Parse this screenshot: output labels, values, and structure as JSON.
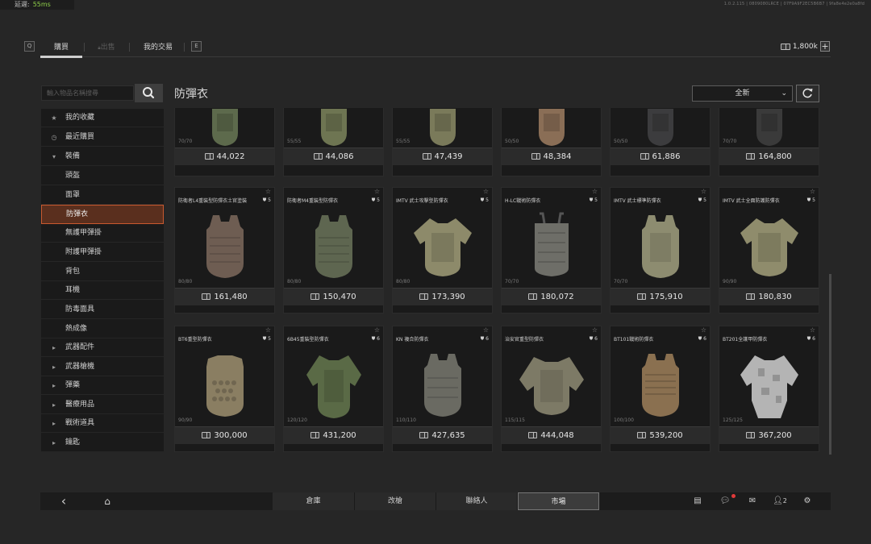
{
  "latency": {
    "label": "延遲:",
    "value": "55ms"
  },
  "build_info": "1.0.2.115 | 0809080LRCE | 07F9A9F2EC5B6B7 | 9fa8e4e2e0a8fd",
  "tabs": {
    "key_left": "Q",
    "buy": "購買",
    "sell": "出售",
    "my_trades": "我的交易",
    "key_right": "E"
  },
  "currency": {
    "amount": "1,800k",
    "plus": "+"
  },
  "search": {
    "placeholder": "輸入物品名稱搜尋"
  },
  "sidebar": {
    "items": [
      {
        "icon": "★",
        "label": "我的收藏"
      },
      {
        "icon": "◷",
        "label": "最近購買"
      },
      {
        "icon": "▾",
        "label": "裝備"
      },
      {
        "icon": "",
        "label": "頭盔"
      },
      {
        "icon": "",
        "label": "面罩"
      },
      {
        "icon": "",
        "label": "防彈衣"
      },
      {
        "icon": "",
        "label": "無護甲彈掛"
      },
      {
        "icon": "",
        "label": "附護甲彈掛"
      },
      {
        "icon": "",
        "label": "背包"
      },
      {
        "icon": "",
        "label": "耳機"
      },
      {
        "icon": "",
        "label": "防毒面具"
      },
      {
        "icon": "",
        "label": "熱成像"
      },
      {
        "icon": "▸",
        "label": "武器配件"
      },
      {
        "icon": "▸",
        "label": "武器槍機"
      },
      {
        "icon": "▸",
        "label": "彈藥"
      },
      {
        "icon": "▸",
        "label": "醫療用品"
      },
      {
        "icon": "▸",
        "label": "戰術道具"
      },
      {
        "icon": "▸",
        "label": "鑰匙"
      }
    ]
  },
  "main": {
    "title": "防彈衣",
    "filter": "全新"
  },
  "items_row1": [
    {
      "durability": "70/70",
      "price": "44,022",
      "color": "#5d6a4c"
    },
    {
      "durability": "55/55",
      "price": "44,086",
      "color": "#6e7552"
    },
    {
      "durability": "55/55",
      "price": "47,439",
      "color": "#7a7a5a"
    },
    {
      "durability": "50/50",
      "price": "48,384",
      "color": "#8a6e56"
    },
    {
      "durability": "50/50",
      "price": "61,886",
      "color": "#3c3c3e"
    },
    {
      "durability": "70/70",
      "price": "164,800",
      "color": "#3a3a3a"
    }
  ],
  "items_row2": [
    {
      "name": "防衛者L4重裝型防彈衣土官塗裝",
      "class": "5",
      "durability": "80/80",
      "price": "161,480",
      "color": "#6e5d52"
    },
    {
      "name": "防衛者M4重裝型防彈衣",
      "class": "5",
      "durability": "80/80",
      "price": "150,470",
      "color": "#5e6650"
    },
    {
      "name": "IMTV 武士攻擊型防彈衣",
      "class": "5",
      "durability": "80/80",
      "price": "173,390",
      "color": "#8d8a6a"
    },
    {
      "name": "H-LC戰術防彈衣",
      "class": "5",
      "durability": "70/70",
      "price": "180,072",
      "color": "#6e6e68"
    },
    {
      "name": "IMTV 武士標準防彈衣",
      "class": "5",
      "durability": "70/70",
      "price": "175,910",
      "color": "#8d8c70"
    },
    {
      "name": "IMTV 武士全面防護防彈衣",
      "class": "5",
      "durability": "90/90",
      "price": "180,830",
      "color": "#8f8c6c"
    }
  ],
  "items_row3": [
    {
      "name": "BT6重型防彈衣",
      "class": "5",
      "durability": "90/90",
      "price": "300,000",
      "color": "#8a7e62"
    },
    {
      "name": "6B45重裝型防彈衣",
      "class": "6",
      "durability": "120/120",
      "price": "431,200",
      "color": "#5a6a46"
    },
    {
      "name": "KN 複合防彈衣",
      "class": "6",
      "durability": "110/110",
      "price": "427,635",
      "color": "#6a6a62"
    },
    {
      "name": "治安官重型防彈衣",
      "class": "6",
      "durability": "115/115",
      "price": "444,048",
      "color": "#7d7a66"
    },
    {
      "name": "BT101戰術防彈衣",
      "class": "6",
      "durability": "100/100",
      "price": "539,200",
      "color": "#8a7050"
    },
    {
      "name": "BT201全護甲防彈衣",
      "class": "6",
      "durability": "125/125",
      "price": "367,200",
      "color": "#b4b4b4"
    }
  ],
  "bottom_nav": {
    "back": "‹",
    "home": "⌂",
    "warehouse": "倉庫",
    "modify": "改槍",
    "contacts": "聯絡人",
    "market": "市場",
    "party_count": "2"
  }
}
